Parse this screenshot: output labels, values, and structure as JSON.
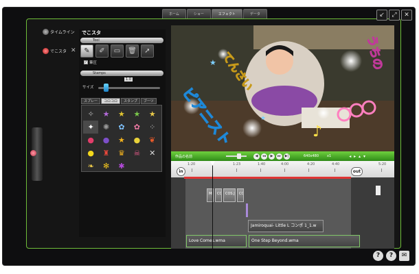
{
  "topnav": [
    "ホーム",
    "ショー",
    "エフェクト",
    "データ"
  ],
  "window_buttons": [
    "↙",
    "⤢",
    "✕"
  ],
  "leftnav": [
    {
      "label": "タイムライン"
    },
    {
      "label": "でこスタ"
    }
  ],
  "panel": {
    "title": "でこスタ",
    "section_tool": "Tool",
    "section_stamps": "Stamps",
    "eraser_label": "筆圧",
    "size_label": "サイズ",
    "size_value": "1.0",
    "tabs": [
      "スプレー",
      "コロコロ",
      "スタンプ",
      "ブーツ"
    ],
    "active_tab": 1
  },
  "preview_text": {
    "left": "ピアニスト",
    "mid": "てんさい",
    "right": "うちの"
  },
  "player": {
    "name": "作品の名前",
    "resolution": "640x480",
    "zoom": "x1",
    "controls": [
      "◀",
      "◂◂",
      "▶",
      "▸▸",
      "▶|"
    ]
  },
  "timeline": {
    "ticks": [
      "1:20",
      "1:23",
      "1:40",
      "4:00",
      "4:20",
      "4:40",
      "5:20"
    ],
    "in_label": "in",
    "out_label": "out",
    "clips": [
      "Mi",
      "CO",
      "COS.J",
      "CO"
    ],
    "audio_clips": [
      {
        "label": "Jamiroquai- Little L コンポ 1_1.w"
      },
      {
        "label": "Love Comes.wma"
      },
      {
        "label": "One Step Beyond.wma"
      }
    ]
  },
  "bottom_icons": [
    "?",
    "?",
    "✉"
  ]
}
